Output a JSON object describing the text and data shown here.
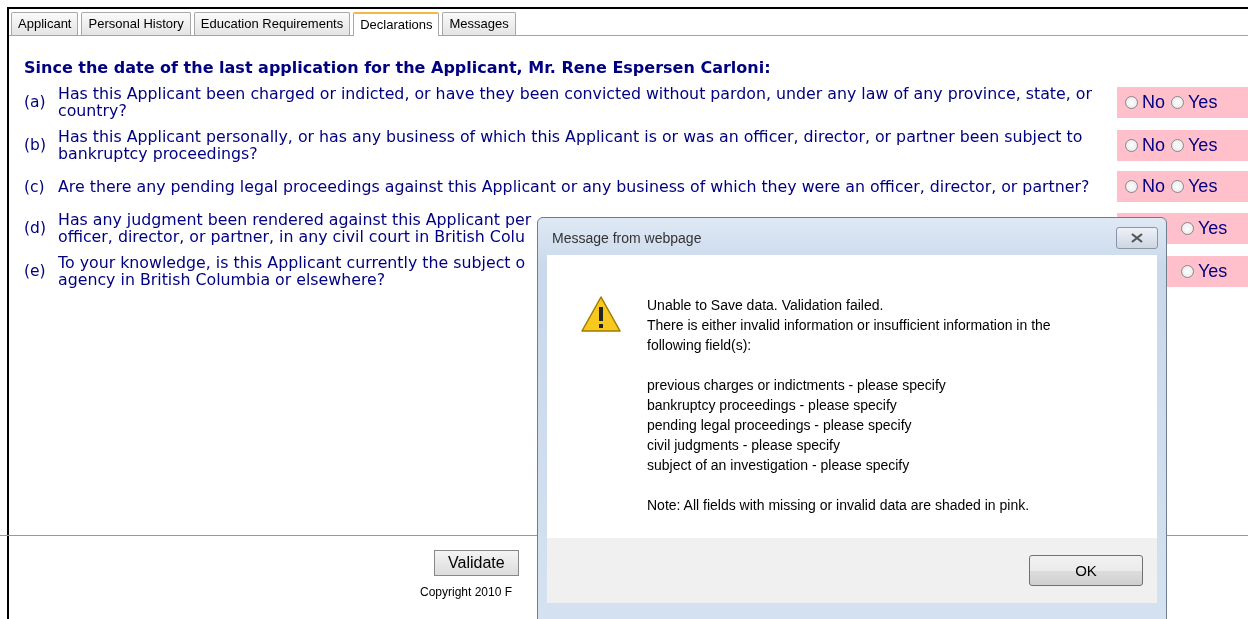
{
  "tabs": [
    {
      "label": "Applicant",
      "selected": false
    },
    {
      "label": "Personal History",
      "selected": false
    },
    {
      "label": "Education Requirements",
      "selected": false
    },
    {
      "label": "Declarations",
      "selected": true
    },
    {
      "label": "Messages",
      "selected": false
    }
  ],
  "heading": "Since the date of the last application for the Applicant, Mr. Rene Espersen Carloni:",
  "questions": [
    {
      "letter": "(a)",
      "lines": [
        "Has this Applicant been charged or indicted, or have they been convicted without pardon, under any law of any province, state, or",
        "country?"
      ],
      "invalid": true,
      "options": [
        {
          "label": "No",
          "selected": false
        },
        {
          "label": "Yes",
          "selected": false
        }
      ]
    },
    {
      "letter": "(b)",
      "lines": [
        "Has this Applicant personally, or has any business of which this Applicant is or was an officer, director, or partner been subject to",
        "bankruptcy proceedings?"
      ],
      "invalid": true,
      "options": [
        {
          "label": "No",
          "selected": false
        },
        {
          "label": "Yes",
          "selected": false
        }
      ]
    },
    {
      "letter": "(c)",
      "lines": [
        "Are there any pending legal proceedings against this Applicant or any business of which they were an officer, director, or partner?"
      ],
      "invalid": true,
      "options": [
        {
          "label": "No",
          "selected": false
        },
        {
          "label": "Yes",
          "selected": false
        }
      ]
    },
    {
      "letter": "(d)",
      "lines": [
        "Has any judgment been rendered against this Applicant per",
        "officer, director, or partner, in any civil court in British Colu"
      ],
      "invalid": true,
      "options": [
        {
          "label": "Yes",
          "selected": false
        }
      ]
    },
    {
      "letter": "(e)",
      "lines": [
        "To your knowledge, is this Applicant currently the subject o",
        "agency in British Columbia or elsewhere?"
      ],
      "invalid": true,
      "options": [
        {
          "label": "Yes",
          "selected": false
        }
      ]
    }
  ],
  "footer": {
    "button": "Validate",
    "copyright": "Copyright 2010 F"
  },
  "dialog": {
    "title": "Message from webpage",
    "message": [
      "Unable to Save data. Validation failed.",
      "There is either invalid information or insufficient information in the",
      "following field(s):"
    ],
    "fields": [
      "previous charges or indictments - please specify",
      "bankruptcy proceedings - please specify",
      "pending legal proceedings - please specify",
      "civil judgments - please specify",
      "subject of an investigation - please specify"
    ],
    "note": "Note: All fields with missing or invalid data are shaded in pink.",
    "button": "OK"
  }
}
